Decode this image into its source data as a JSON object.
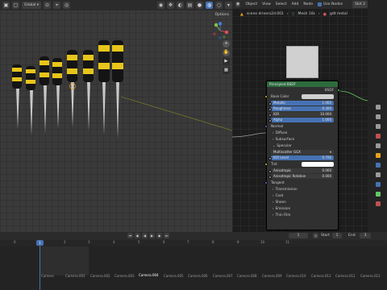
{
  "viewport": {
    "header": {
      "transform_orientation": "Global",
      "options_label": "Options"
    }
  },
  "node_editor": {
    "header": {
      "editor_type": "Object",
      "menus": [
        "View",
        "Select",
        "Add",
        "Node"
      ],
      "use_nodes": "Use Nodes",
      "slot": "Slot 2"
    },
    "breadcrumb": [
      "scene drivers2d.001",
      "Mesh 10s",
      "gdt metal"
    ],
    "bsdf": {
      "title": "Principled BSDF",
      "output": "BSDF",
      "base_color": "Base Color",
      "metallic": {
        "label": "Metallic",
        "value": "1.000"
      },
      "roughness": {
        "label": "Roughness",
        "value": "0.300"
      },
      "ior": {
        "label": "IOR",
        "value": "10.000"
      },
      "alpha": {
        "label": "Alpha",
        "value": "1.000"
      },
      "normal": "Normal",
      "diffuse": "Diffuse",
      "subsurface": "Subsurface",
      "specular": "Specular",
      "distribution": "Multiscatter GGX",
      "ior_level": {
        "label": "IOR Level",
        "value": "0.706"
      },
      "tint": "Tint",
      "anisotropic": {
        "label": "Anisotropic",
        "value": "0.000"
      },
      "anisotropic_rotation": {
        "label": "Anisotropic Rotation",
        "value": "0.000"
      },
      "tangent": "Tangent",
      "transmission": "Transmission",
      "coat": "Coat",
      "sheen": "Sheen",
      "emission": "Emission",
      "thin_film": "Thin Film"
    }
  },
  "timeline": {
    "current_frame": "1",
    "start_label": "Start",
    "start_value": "1",
    "end_label": "End",
    "end_value": "3",
    "ruler": [
      "0",
      "1",
      "2",
      "3",
      "4",
      "5",
      "6",
      "7",
      "8",
      "9",
      "10",
      "11"
    ],
    "markers": [
      "Camera",
      "Camera.001",
      "Camera.002",
      "Camera.003",
      "Camera.004",
      "Camera.005",
      "Camera.006",
      "Camera.007",
      "Camera.008",
      "Camera.009",
      "Camera.010",
      "Camera.011",
      "Camera.012",
      "Camera.013"
    ]
  },
  "colors": {
    "accent": "#4772b3",
    "node_header": "#2c6b3d",
    "handle_yellow": "#e8c51a",
    "handle_black": "#141414"
  }
}
